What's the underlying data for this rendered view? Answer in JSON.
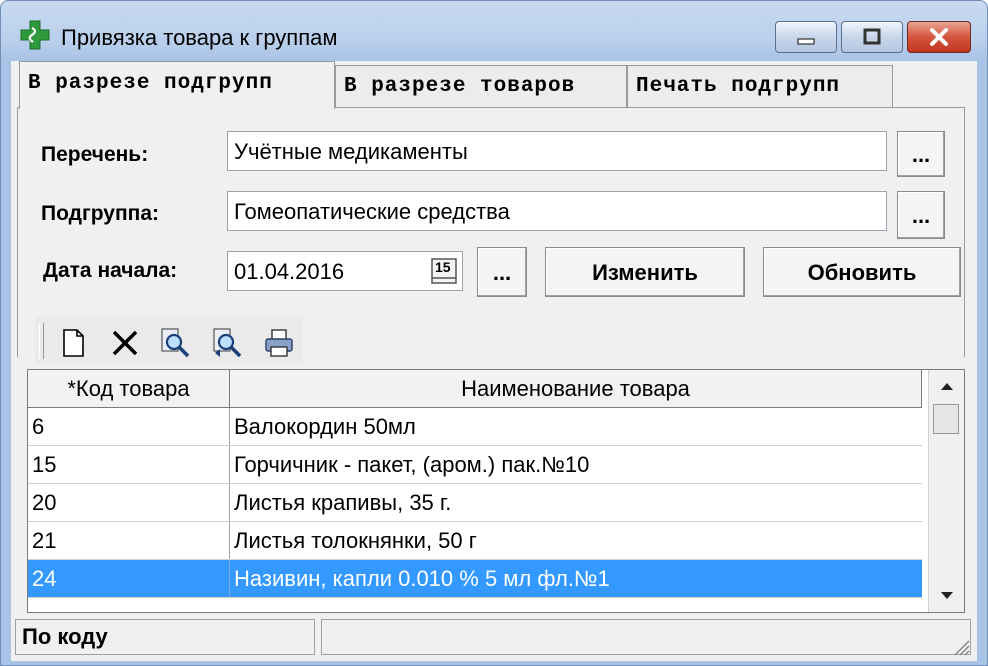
{
  "window": {
    "title": "Привязка товара к группам",
    "accent": "#3399ff"
  },
  "tabs": [
    {
      "label": "В разрезе подгрупп",
      "active": true
    },
    {
      "label": "В разрезе товаров",
      "active": false
    },
    {
      "label": "Печать подгрупп",
      "active": false
    }
  ],
  "form": {
    "list_label": "Перечень:",
    "list_value": "Учётные медикаменты",
    "subgroup_label": "Подгруппа:",
    "subgroup_value": "Гомеопатические средства",
    "date_label": "Дата начала:",
    "date_value": "01.04.2016",
    "calendar_glyph": "15",
    "browse_label": "...",
    "change_label": "Изменить",
    "refresh_label": "Обновить"
  },
  "toolbar": {
    "icons": [
      "new-document-icon",
      "delete-cross-icon",
      "find-icon",
      "find-next-icon",
      "print-icon"
    ]
  },
  "grid": {
    "columns": [
      "*Код товара",
      "Наименование товара"
    ],
    "rows": [
      {
        "code": "6",
        "name": "Валокордин 50мл"
      },
      {
        "code": "15",
        "name": "Горчичник - пакет, (аром.) пак.№10"
      },
      {
        "code": "20",
        "name": "Листья крапивы,  35 г."
      },
      {
        "code": "21",
        "name": "Листья толокнянки, 50 г"
      },
      {
        "code": "24",
        "name": "Називин, капли 0.010 % 5 мл фл.№1",
        "selected": true
      }
    ]
  },
  "status": {
    "mode": "По коду",
    "info": ""
  }
}
